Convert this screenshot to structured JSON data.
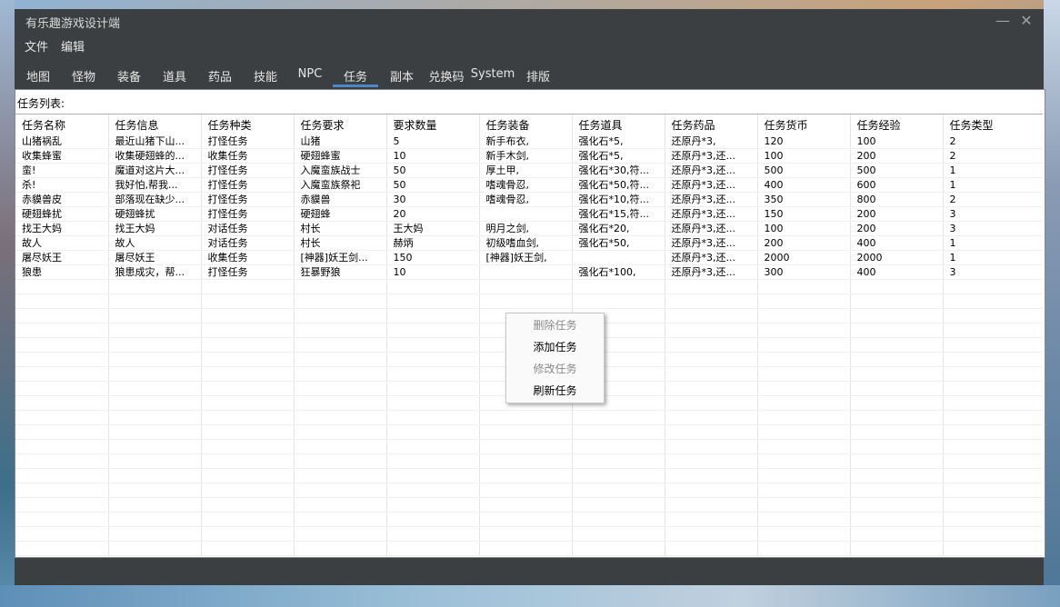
{
  "window": {
    "title": "有乐趣游戏设计端",
    "minimize_glyph": "—",
    "close_glyph": "✕"
  },
  "menu": {
    "items": [
      "文件",
      "编辑"
    ]
  },
  "tabs": [
    {
      "label": "地图"
    },
    {
      "label": "怪物"
    },
    {
      "label": "装备"
    },
    {
      "label": "道具"
    },
    {
      "label": "药品"
    },
    {
      "label": "技能"
    },
    {
      "label": "NPC"
    },
    {
      "label": "任务",
      "active": true
    },
    {
      "label": "副本"
    },
    {
      "label": "兑换码"
    },
    {
      "label": "System"
    },
    {
      "label": "排版"
    }
  ],
  "panel": {
    "label": "任务列表:"
  },
  "table": {
    "columns": [
      "任务名称",
      "任务信息",
      "任务种类",
      "任务要求",
      "要求数量",
      "任务装备",
      "任务道具",
      "任务药品",
      "任务货币",
      "任务经验",
      "任务类型"
    ],
    "rows": [
      [
        "山猪祸乱",
        "最近山猪下山...",
        "打怪任务",
        "山猪",
        "5",
        "新手布衣,",
        "强化石*5,",
        "还原丹*3,",
        "120",
        "100",
        "2"
      ],
      [
        "收集蜂蜜",
        "收集硬翅蜂的...",
        "收集任务",
        "硬翅蜂蜜",
        "10",
        "新手木剑,",
        "强化石*5,",
        "还原丹*3,还...",
        "100",
        "200",
        "2"
      ],
      [
        "蛮!",
        "魔道对这片大...",
        "打怪任务",
        "入魔蛮族战士",
        "50",
        "厚土甲,",
        "强化石*30,符...",
        "还原丹*3,还...",
        "500",
        "500",
        "1"
      ],
      [
        "杀!",
        "我好怕,帮我...",
        "打怪任务",
        "入魔蛮族祭祀",
        "50",
        "嗜魂骨忍,",
        "强化石*50,符...",
        "还原丹*3,还...",
        "400",
        "600",
        "1"
      ],
      [
        "赤貘兽皮",
        "部落现在缺少...",
        "打怪任务",
        "赤貘兽",
        "30",
        "嗜魂骨忍,",
        "强化石*10,符...",
        "还原丹*3,还...",
        "350",
        "800",
        "2"
      ],
      [
        "硬翅蜂扰",
        "硬翅蜂扰",
        "打怪任务",
        "硬翅蜂",
        "20",
        "",
        "强化石*15,符...",
        "还原丹*3,还...",
        "150",
        "200",
        "3"
      ],
      [
        "找王大妈",
        "找王大妈",
        "对话任务",
        "村长",
        "王大妈",
        "明月之剑,",
        "强化石*20,",
        "还原丹*3,还...",
        "100",
        "200",
        "3"
      ],
      [
        "故人",
        "故人",
        "对话任务",
        "村长",
        "赫炳",
        "初级嗜血剑,",
        "强化石*50,",
        "还原丹*3,还...",
        "200",
        "400",
        "1"
      ],
      [
        "屠尽妖王",
        "屠尽妖王",
        "收集任务",
        "[神器]妖王剑...",
        "150",
        "[神器]妖王剑,",
        "",
        "还原丹*3,还...",
        "2000",
        "2000",
        "1"
      ],
      [
        "狼患",
        "狼患成灾，帮...",
        "打怪任务",
        "狂暴野狼",
        "10",
        "",
        "强化石*100,",
        "还原丹*3,还...",
        "300",
        "400",
        "3"
      ]
    ]
  },
  "context_menu": {
    "items": [
      {
        "label": "删除任务",
        "enabled": false
      },
      {
        "label": "添加任务",
        "enabled": true
      },
      {
        "label": "修改任务",
        "enabled": false
      },
      {
        "label": "刷新任务",
        "enabled": true
      }
    ]
  },
  "colors": {
    "window_bg": "#3c3f41",
    "tab_underline": "#4a88c7",
    "panel_bg": "#ffffff"
  }
}
